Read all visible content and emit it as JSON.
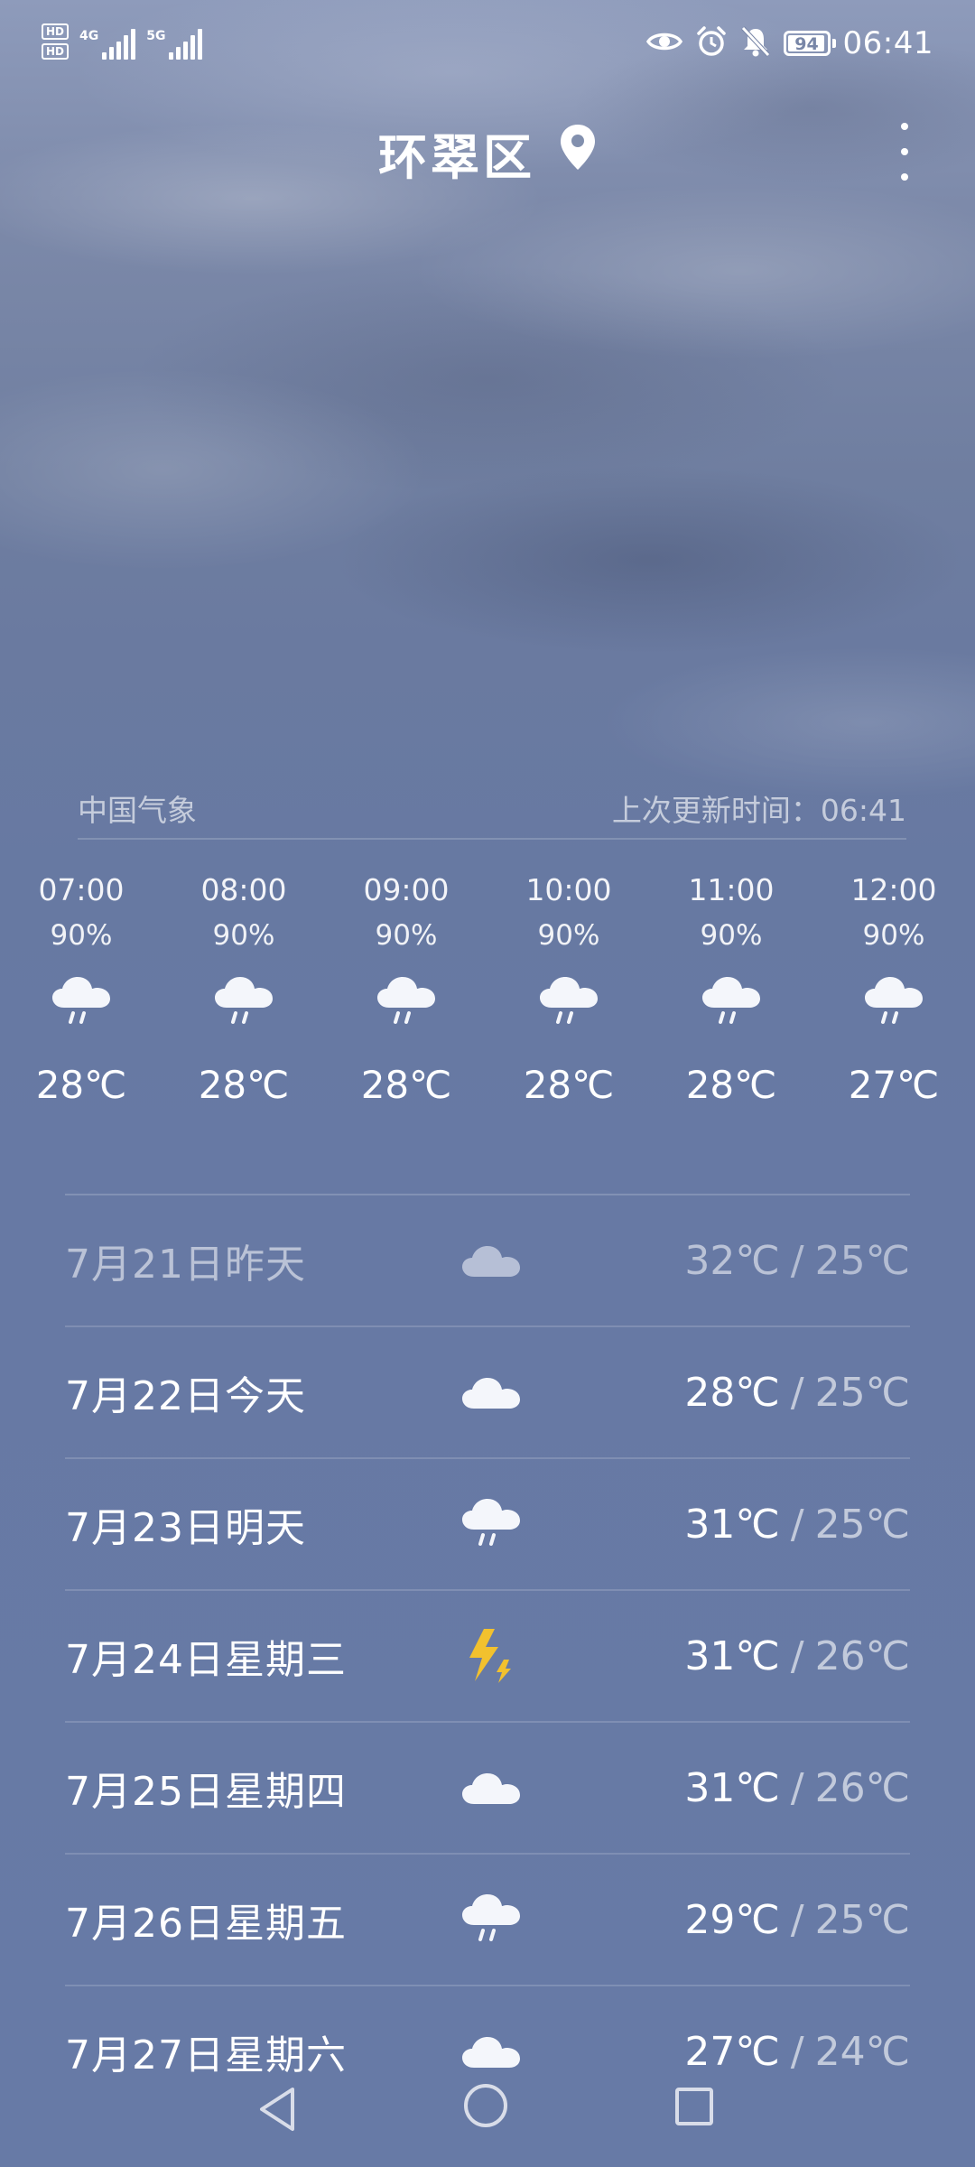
{
  "status_bar": {
    "sim1_label": "HD",
    "sim2_label": "HD",
    "net1": "4G",
    "net2": "5G",
    "battery": "94",
    "time": "06:41",
    "icons": [
      "eye-icon",
      "alarm-icon",
      "mute-bell-icon"
    ]
  },
  "header": {
    "location": "环翠区",
    "location_icon": "location-pin-icon",
    "menu_icon": "more-vertical-icon"
  },
  "source": {
    "provider": "中国气象",
    "updated": "上次更新时间：06:41"
  },
  "hourly": [
    {
      "time": "07:00",
      "precip": "90%",
      "icon": "rain-cloud-icon",
      "temp": "28℃"
    },
    {
      "time": "08:00",
      "precip": "90%",
      "icon": "rain-cloud-icon",
      "temp": "28℃"
    },
    {
      "time": "09:00",
      "precip": "90%",
      "icon": "rain-cloud-icon",
      "temp": "28℃"
    },
    {
      "time": "10:00",
      "precip": "90%",
      "icon": "rain-cloud-icon",
      "temp": "28℃"
    },
    {
      "time": "11:00",
      "precip": "90%",
      "icon": "rain-cloud-icon",
      "temp": "28℃"
    },
    {
      "time": "12:00",
      "precip": "90%",
      "icon": "rain-cloud-icon",
      "temp": "27℃"
    }
  ],
  "daily": [
    {
      "date": "7月21日昨天",
      "icon": "cloud-icon",
      "high": "32℃",
      "sep": "/",
      "low": "25℃",
      "past": true
    },
    {
      "date": "7月22日今天",
      "icon": "cloud-icon",
      "high": "28℃",
      "sep": "/",
      "low": "25℃",
      "past": false
    },
    {
      "date": "7月23日明天",
      "icon": "rain-cloud-icon",
      "high": "31℃",
      "sep": "/",
      "low": "25℃",
      "past": false
    },
    {
      "date": "7月24日星期三",
      "icon": "thunder-icon",
      "high": "31℃",
      "sep": "/",
      "low": "26℃",
      "past": false
    },
    {
      "date": "7月25日星期四",
      "icon": "cloud-icon",
      "high": "31℃",
      "sep": "/",
      "low": "26℃",
      "past": false
    },
    {
      "date": "7月26日星期五",
      "icon": "rain-cloud-icon",
      "high": "29℃",
      "sep": "/",
      "low": "25℃",
      "past": false
    },
    {
      "date": "7月27日星期六",
      "icon": "cloud-icon",
      "high": "27℃",
      "sep": "/",
      "low": "24℃",
      "past": false
    }
  ],
  "navbar": {
    "icons": [
      "back-icon",
      "home-icon",
      "recent-apps-icon"
    ]
  }
}
